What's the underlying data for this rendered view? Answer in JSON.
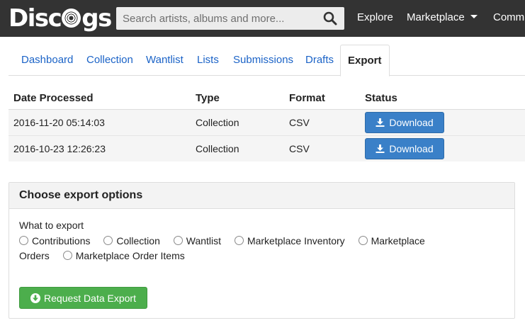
{
  "header": {
    "logo_text": "Discogs",
    "search": {
      "placeholder": "Search artists, albums and more...",
      "value": "",
      "icon": "search-icon"
    },
    "nav": [
      {
        "label": "Explore"
      },
      {
        "label": "Marketplace",
        "has_dropdown": true
      },
      {
        "label": "Comm"
      }
    ]
  },
  "tabs": [
    {
      "label": "Dashboard",
      "active": false
    },
    {
      "label": "Collection",
      "active": false
    },
    {
      "label": "Wantlist",
      "active": false
    },
    {
      "label": "Lists",
      "active": false
    },
    {
      "label": "Submissions",
      "active": false
    },
    {
      "label": "Drafts",
      "active": false
    },
    {
      "label": "Export",
      "active": true
    }
  ],
  "exports_table": {
    "columns": [
      "Date Processed",
      "Type",
      "Format",
      "Status"
    ],
    "rows": [
      {
        "date": "2016-11-20 05:14:03",
        "type": "Collection",
        "format": "CSV",
        "status_button": "Download"
      },
      {
        "date": "2016-10-23 12:26:23",
        "type": "Collection",
        "format": "CSV",
        "status_button": "Download"
      }
    ]
  },
  "export_options": {
    "title": "Choose export options",
    "what_label": "What to export",
    "options": [
      {
        "label": "Contributions",
        "selected": false
      },
      {
        "label": "Collection",
        "selected": false
      },
      {
        "label": "Wantlist",
        "selected": false
      },
      {
        "label": "Marketplace Inventory",
        "selected": false
      },
      {
        "label": "Marketplace Orders",
        "selected": false
      },
      {
        "label": "Marketplace Order Items",
        "selected": false
      }
    ],
    "submit_label": "Request Data Export"
  },
  "colors": {
    "topbar": "#333333",
    "link": "#1b63c7",
    "download_button": "#3a80c8",
    "request_button": "#4cae4c"
  }
}
